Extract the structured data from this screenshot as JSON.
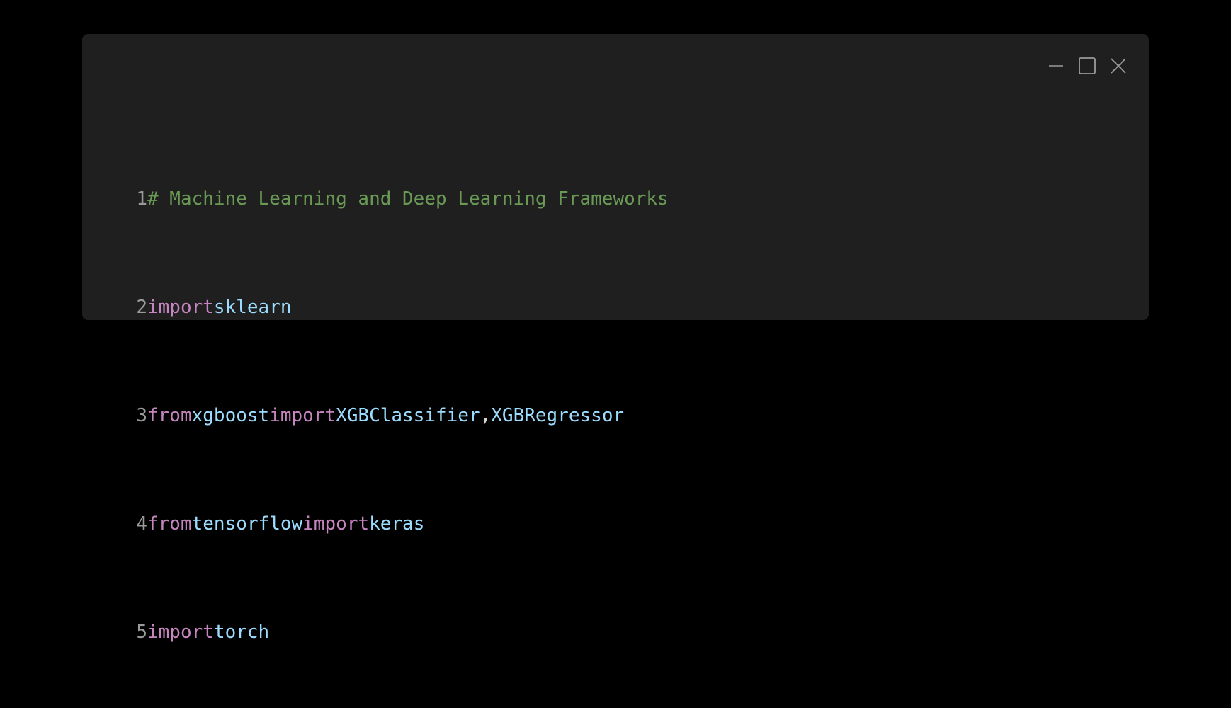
{
  "window": {
    "controls": [
      {
        "name": "minimize-icon"
      },
      {
        "name": "maximize-icon"
      },
      {
        "name": "close-icon"
      }
    ]
  },
  "code": {
    "lines": [
      {
        "number": "1",
        "comment": "# Machine Learning and Deep Learning Frameworks"
      },
      {
        "number": "2",
        "kw1": "import",
        "mod": "sklearn"
      },
      {
        "number": "3",
        "kw1": "from",
        "mod": "xgboost",
        "kw2": "import",
        "name1": "XGBClassifier",
        "sep": ",",
        "name2": "XGBRegressor"
      },
      {
        "number": "4",
        "kw1": "from",
        "mod": "tensorflow",
        "kw2": "import",
        "name1": "keras"
      },
      {
        "number": "5",
        "kw1": "import",
        "mod": "torch"
      }
    ]
  },
  "colors": {
    "background": "#000000",
    "window": "#1f1f1f",
    "comment": "#6a9955",
    "keyword": "#c586c0",
    "identifier": "#9cdcfe",
    "line_number": "#9a9a9a"
  }
}
